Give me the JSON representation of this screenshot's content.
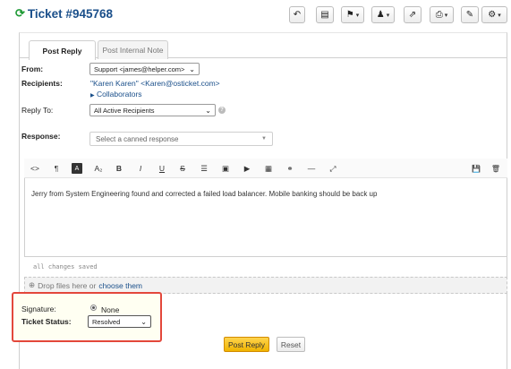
{
  "header": {
    "title": "Ticket #945768",
    "refresh_icon": "refresh-icon"
  },
  "toolbar": {
    "buttons": [
      {
        "name": "undo-icon",
        "glyph": "↶"
      },
      {
        "name": "print-page-icon",
        "glyph": "▤"
      },
      {
        "name": "flag-icon",
        "glyph": "⚑",
        "caret": "▾"
      },
      {
        "name": "user-icon",
        "glyph": "♟",
        "caret": "▾"
      },
      {
        "name": "share-icon",
        "glyph": "⇗"
      },
      {
        "name": "printer-icon",
        "glyph": "⎙",
        "caret": "▾"
      },
      {
        "name": "edit-icon",
        "glyph": "✎"
      },
      {
        "name": "gear-icon",
        "glyph": "⚙",
        "caret": "▾"
      }
    ]
  },
  "tabs": [
    {
      "label": "Post Reply",
      "active": true
    },
    {
      "label": "Post Internal Note",
      "active": false
    }
  ],
  "form": {
    "from_label": "From:",
    "from_value": "Support <james@helper.com>",
    "recipients_label": "Recipients:",
    "recipients_name": "\"Karen Karen\"",
    "recipients_email": "<Karen@osticket.com>",
    "collaborators_label": "Collaborators",
    "reply_to_label": "Reply To:",
    "reply_to_value": "All Active Recipients",
    "response_label": "Response:",
    "canned_placeholder": "Select a canned response"
  },
  "editor": {
    "tools": [
      {
        "name": "code-icon",
        "glyph": "<>"
      },
      {
        "name": "paragraph-icon",
        "glyph": "¶"
      },
      {
        "name": "font-style-icon",
        "glyph": "A"
      },
      {
        "name": "font-size-icon",
        "glyph": "A₂"
      },
      {
        "name": "bold-icon",
        "glyph": "B"
      },
      {
        "name": "italic-icon",
        "glyph": "I"
      },
      {
        "name": "underline-icon",
        "glyph": "U"
      },
      {
        "name": "strikethrough-icon",
        "glyph": "S"
      },
      {
        "name": "list-icon",
        "glyph": "☰"
      },
      {
        "name": "image-icon",
        "glyph": "▣"
      },
      {
        "name": "video-icon",
        "glyph": "▶"
      },
      {
        "name": "table-icon",
        "glyph": "▦"
      },
      {
        "name": "link-icon",
        "glyph": "⚭"
      },
      {
        "name": "horizontal-rule-icon",
        "glyph": "—"
      },
      {
        "name": "fullscreen-icon",
        "glyph": "⤢"
      }
    ],
    "right_tools": [
      {
        "name": "save-draft-icon",
        "glyph": "💾"
      },
      {
        "name": "delete-draft-icon",
        "glyph": "🗑"
      }
    ],
    "content": "Jerry from System Engineering found and corrected a failed load balancer. Mobile banking should be back up",
    "saved_status": "all changes saved"
  },
  "attachments": {
    "drop_text": "Drop files here or",
    "choose_link": "choose them"
  },
  "signature": {
    "label": "Signature:",
    "value": "None"
  },
  "ticket_status": {
    "label": "Ticket Status:",
    "value": "Resolved"
  },
  "actions": {
    "post_reply": "Post Reply",
    "reset": "Reset"
  },
  "colors": {
    "accent_link": "#1a4f8a",
    "primary_button": "#f0b400",
    "highlight_border": "#e3473b"
  }
}
